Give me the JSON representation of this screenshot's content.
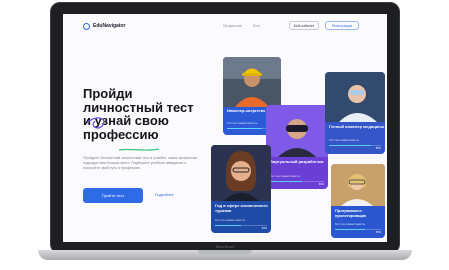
{
  "device": {
    "brand": "MacBook"
  },
  "nav": {
    "logo_text": "EduNavigator",
    "logo_sub": "• •",
    "links": [
      "Профессии",
      "Блог"
    ],
    "login_label": "Мой кабинет",
    "register_label": "Регистрация"
  },
  "hero": {
    "title_lines": [
      "Пройди",
      "личностный тест",
      "и узнай свою",
      "профессию"
    ],
    "description": "Пройдите бесплатный личностный тест и узнайте, какие профессии подходят вам больше всего. Подберите учебные заведения и постройте свой путь в профессию.",
    "cta_label": "Пройти тест",
    "link_label": "Подробнее"
  },
  "cards": [
    {
      "title": "Инженер-энергетик",
      "subtitle": "Тест на совместимость",
      "progress": 0.7,
      "pct": "70%",
      "color": "#2d5bd7"
    },
    {
      "title": "Виртуальный разработчик",
      "subtitle": "Тест на совместимость",
      "progress": 0.6,
      "pct": "60%",
      "color": "#6b3fd6"
    },
    {
      "title": "Генный инженер медицины",
      "subtitle": "Тест на совместимость",
      "progress": 0.8,
      "pct": "80%",
      "color": "#3456c9"
    },
    {
      "title": "Гид в сфере космического туризма",
      "subtitle": "Тест на совместимость",
      "progress": 0.5,
      "pct": "50%",
      "color": "#1e4aa8"
    },
    {
      "title": "Программист-проектировщик",
      "subtitle": "Тест на совместимость",
      "progress": 0.65,
      "pct": "65%",
      "color": "#2a57cf"
    }
  ]
}
